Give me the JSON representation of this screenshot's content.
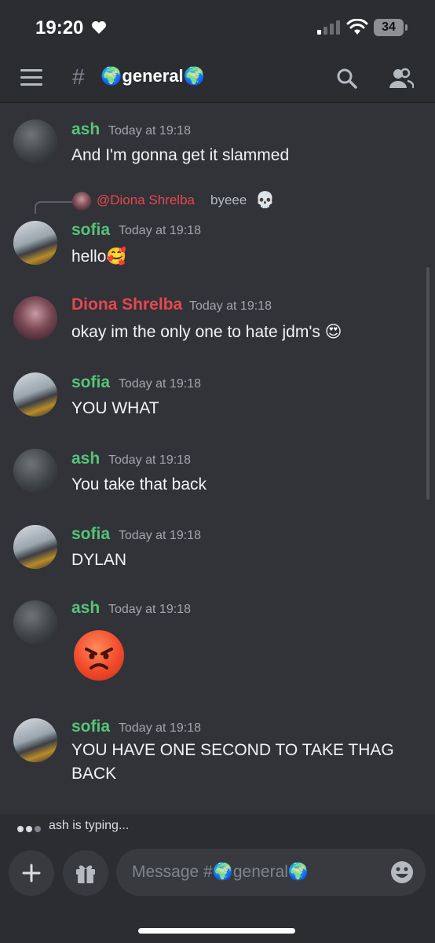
{
  "status_bar": {
    "time": "19:20",
    "battery": "34"
  },
  "header": {
    "hash": "#",
    "channel_emoji": "🌍",
    "channel_name": "general",
    "channel_emoji_end": "🌍"
  },
  "messages": [
    {
      "author": "ash",
      "author_color": "#57c47a",
      "timestamp": "Today at 19:18",
      "text": "And I'm gonna get it slammed"
    },
    {
      "reply_to": {
        "mention": "@Diona Shrelba",
        "text": "byeee",
        "emoji": "💀"
      },
      "author": "sofia",
      "author_color": "#57c47a",
      "timestamp": "Today at 19:18",
      "text": "hello🥰"
    },
    {
      "author": "Diona Shrelba",
      "author_color": "#e5484d",
      "timestamp": "Today at 19:18",
      "text": "okay im the only one to hate jdm's 😍"
    },
    {
      "author": "sofia",
      "author_color": "#57c47a",
      "timestamp": "Today at 19:18",
      "text": "YOU WHAT"
    },
    {
      "author": "ash",
      "author_color": "#57c47a",
      "timestamp": "Today at 19:18",
      "text": "You take that back"
    },
    {
      "author": "sofia",
      "author_color": "#57c47a",
      "timestamp": "Today at 19:18",
      "text": "DYLAN"
    },
    {
      "author": "ash",
      "author_color": "#57c47a",
      "timestamp": "Today at 19:18",
      "emoji": "angry-face"
    },
    {
      "author": "sofia",
      "author_color": "#57c47a",
      "timestamp": "Today at 19:18",
      "text_line1": "YOU HAVE ONE SECOND TO TAKE THAG",
      "text_line2": "BACK"
    }
  ],
  "typing": {
    "text": "ash is typing..."
  },
  "composer": {
    "placeholder": "Message #🌍general🌍"
  },
  "icons": [
    "heart-icon",
    "signal-icon",
    "wifi-icon",
    "battery-icon",
    "hamburger-icon",
    "search-icon",
    "members-icon",
    "plus-icon",
    "gift-icon",
    "emoji-icon",
    "skull-icon",
    "angry-face-icon"
  ]
}
